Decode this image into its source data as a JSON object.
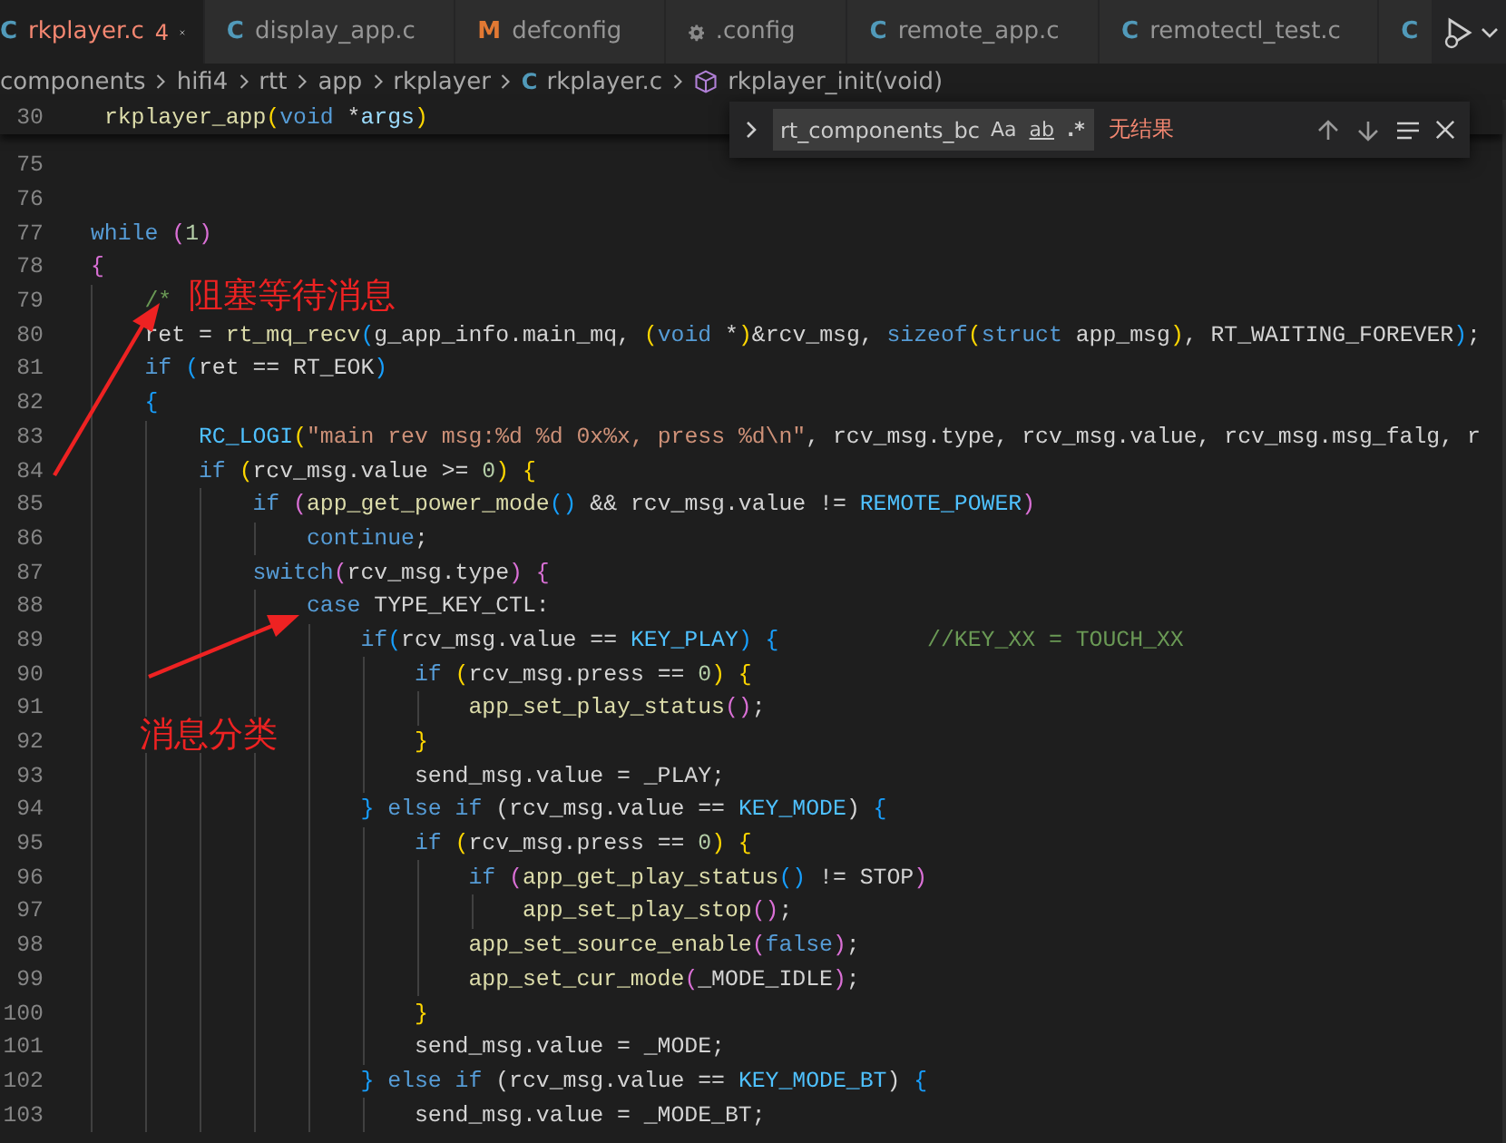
{
  "tabs": [
    {
      "label": "rkplayer.c",
      "kind": "c",
      "glyph": "C",
      "badge": "4",
      "selected": true
    },
    {
      "label": "display_app.c",
      "kind": "c",
      "glyph": "C",
      "selected": false
    },
    {
      "label": "defconfig",
      "kind": "makefile",
      "glyph": "M",
      "selected": false
    },
    {
      "label": ".config",
      "kind": "config",
      "selected": false
    },
    {
      "label": "remote_app.c",
      "kind": "c",
      "glyph": "C",
      "selected": false
    },
    {
      "label": "remotectl_test.c",
      "kind": "c",
      "glyph": "C",
      "selected": false
    },
    {
      "kind": "c",
      "glyph": "C",
      "selected": false
    }
  ],
  "breadcrumbs": [
    {
      "label": "components",
      "kind": "folder"
    },
    {
      "label": "hifi4",
      "kind": "folder"
    },
    {
      "label": "rtt",
      "kind": "folder"
    },
    {
      "label": "app",
      "kind": "folder"
    },
    {
      "label": "rkplayer",
      "kind": "folder"
    },
    {
      "label": "rkplayer.c",
      "kind": "file",
      "glyph": "C"
    },
    {
      "label": "rkplayer_init(void)",
      "kind": "function"
    }
  ],
  "sticky_line": {
    "number": "30",
    "tokens": [
      {
        "t": " rkplayer_app",
        "kind": "fn"
      },
      {
        "t": "(",
        "kind": "b1"
      },
      {
        "t": "void",
        "kind": "kw"
      },
      {
        "t": " *",
        "kind": "plain"
      },
      {
        "t": "args",
        "kind": "var"
      },
      {
        "t": ")",
        "kind": "b1"
      }
    ]
  },
  "find_widget": {
    "value": "rt_components_bc",
    "options": [
      {
        "label": "Aa",
        "kind": "case"
      },
      {
        "label": "ab",
        "kind": "word"
      },
      {
        "label": ".*",
        "kind": "regex"
      }
    ],
    "result": "无结果"
  },
  "code_lines": [
    {
      "number": "75"
    },
    {
      "number": "76"
    },
    {
      "number": "77",
      "tokens": [
        {
          "t": "while ",
          "kind": "kw"
        },
        {
          "t": "(",
          "kind": "b2"
        },
        {
          "t": "1",
          "kind": "num"
        },
        {
          "t": ")",
          "kind": "b2"
        }
      ]
    },
    {
      "number": "78",
      "tokens": [
        {
          "t": "{",
          "kind": "b2"
        }
      ]
    },
    {
      "number": "79",
      "tokens": [
        {
          "t": "    /*",
          "kind": "cmt"
        }
      ]
    },
    {
      "number": "80",
      "tokens": [
        {
          "t": "    ret = ",
          "kind": "plain"
        },
        {
          "t": "rt_mq_recv",
          "kind": "fn"
        },
        {
          "t": "(",
          "kind": "b3"
        },
        {
          "t": "g_app_info.main_mq, ",
          "kind": "plain"
        },
        {
          "t": "(",
          "kind": "b1"
        },
        {
          "t": "void",
          "kind": "kw"
        },
        {
          "t": " *",
          "kind": "plain"
        },
        {
          "t": ")",
          "kind": "b1"
        },
        {
          "t": "&rcv_msg, ",
          "kind": "plain"
        },
        {
          "t": "sizeof",
          "kind": "kw"
        },
        {
          "t": "(",
          "kind": "b1"
        },
        {
          "t": "struct",
          "kind": "kw"
        },
        {
          "t": " app_msg",
          "kind": "plain"
        },
        {
          "t": ")",
          "kind": "b1"
        },
        {
          "t": ", RT_WAITING_FOREVER",
          "kind": "plain"
        },
        {
          "t": ")",
          "kind": "b3"
        },
        {
          "t": ";",
          "kind": "plain"
        }
      ]
    },
    {
      "number": "81",
      "tokens": [
        {
          "t": "    if ",
          "kind": "kw"
        },
        {
          "t": "(",
          "kind": "b3"
        },
        {
          "t": "ret == RT_EOK",
          "kind": "plain"
        },
        {
          "t": ")",
          "kind": "b3"
        }
      ]
    },
    {
      "number": "82",
      "tokens": [
        {
          "t": "    {",
          "kind": "b3"
        }
      ]
    },
    {
      "number": "83",
      "tokens": [
        {
          "t": "        RC_LOGI",
          "kind": "const"
        },
        {
          "t": "(",
          "kind": "b1"
        },
        {
          "t": "\"main rev msg:%d %d 0x%x, press %d\\n\"",
          "kind": "str"
        },
        {
          "t": ", rcv_msg.type, rcv_msg.value, rcv_msg.msg_falg, r",
          "kind": "plain"
        }
      ]
    },
    {
      "number": "84",
      "tokens": [
        {
          "t": "        if ",
          "kind": "kw"
        },
        {
          "t": "(",
          "kind": "b1"
        },
        {
          "t": "rcv_msg.value >= ",
          "kind": "plain"
        },
        {
          "t": "0",
          "kind": "num"
        },
        {
          "t": ")",
          "kind": "b1"
        },
        {
          "t": " {",
          "kind": "b1"
        }
      ]
    },
    {
      "number": "85",
      "tokens": [
        {
          "t": "            if ",
          "kind": "kw"
        },
        {
          "t": "(",
          "kind": "b2"
        },
        {
          "t": "app_get_power_mode",
          "kind": "fn"
        },
        {
          "t": "()",
          "kind": "b3"
        },
        {
          "t": " && rcv_msg.value != ",
          "kind": "plain"
        },
        {
          "t": "REMOTE_POWER",
          "kind": "const"
        },
        {
          "t": ")",
          "kind": "b2"
        }
      ]
    },
    {
      "number": "86",
      "tokens": [
        {
          "t": "                continue",
          "kind": "kw"
        },
        {
          "t": ";",
          "kind": "plain"
        }
      ]
    },
    {
      "number": "87",
      "tokens": [
        {
          "t": "            switch",
          "kind": "kw"
        },
        {
          "t": "(",
          "kind": "b2"
        },
        {
          "t": "rcv_msg.type",
          "kind": "plain"
        },
        {
          "t": ")",
          "kind": "b2"
        },
        {
          "t": " {",
          "kind": "b2"
        }
      ]
    },
    {
      "number": "88",
      "tokens": [
        {
          "t": "                case",
          "kind": "kw"
        },
        {
          "t": " TYPE_KEY_CTL:",
          "kind": "plain"
        }
      ]
    },
    {
      "number": "89",
      "tokens": [
        {
          "t": "                    if",
          "kind": "kw"
        },
        {
          "t": "(",
          "kind": "b3"
        },
        {
          "t": "rcv_msg.value == ",
          "kind": "plain"
        },
        {
          "t": "KEY_PLAY",
          "kind": "const"
        },
        {
          "t": ")",
          "kind": "b3"
        },
        {
          "t": " {",
          "kind": "b3"
        },
        {
          "t": "           //KEY_XX = TOUCH_XX",
          "kind": "cmt"
        }
      ]
    },
    {
      "number": "90",
      "tokens": [
        {
          "t": "                        if ",
          "kind": "kw"
        },
        {
          "t": "(",
          "kind": "b1"
        },
        {
          "t": "rcv_msg.press == ",
          "kind": "plain"
        },
        {
          "t": "0",
          "kind": "num"
        },
        {
          "t": ")",
          "kind": "b1"
        },
        {
          "t": " {",
          "kind": "b1"
        }
      ]
    },
    {
      "number": "91",
      "tokens": [
        {
          "t": "                            app_set_play_status",
          "kind": "fn"
        },
        {
          "t": "()",
          "kind": "b2"
        },
        {
          "t": ";",
          "kind": "plain"
        }
      ]
    },
    {
      "number": "92",
      "tokens": [
        {
          "t": "                        }",
          "kind": "b1"
        }
      ]
    },
    {
      "number": "93",
      "tokens": [
        {
          "t": "                        send_msg.value = _PLAY;",
          "kind": "plain"
        }
      ]
    },
    {
      "number": "94",
      "tokens": [
        {
          "t": "                    }",
          "kind": "b3"
        },
        {
          "t": " else if",
          "kind": "kw"
        },
        {
          "t": " (rcv_msg.value == ",
          "kind": "plain"
        },
        {
          "t": "KEY_MODE",
          "kind": "const"
        },
        {
          "t": ")",
          "kind": "plain"
        },
        {
          "t": " {",
          "kind": "b3"
        }
      ]
    },
    {
      "number": "95",
      "tokens": [
        {
          "t": "                        if ",
          "kind": "kw"
        },
        {
          "t": "(",
          "kind": "b1"
        },
        {
          "t": "rcv_msg.press == ",
          "kind": "plain"
        },
        {
          "t": "0",
          "kind": "num"
        },
        {
          "t": ")",
          "kind": "b1"
        },
        {
          "t": " {",
          "kind": "b1"
        }
      ]
    },
    {
      "number": "96",
      "tokens": [
        {
          "t": "                            if ",
          "kind": "kw"
        },
        {
          "t": "(",
          "kind": "b2"
        },
        {
          "t": "app_get_play_status",
          "kind": "fn"
        },
        {
          "t": "()",
          "kind": "b3"
        },
        {
          "t": " != STOP",
          "kind": "plain"
        },
        {
          "t": ")",
          "kind": "b2"
        }
      ]
    },
    {
      "number": "97",
      "tokens": [
        {
          "t": "                                app_set_play_stop",
          "kind": "fn"
        },
        {
          "t": "()",
          "kind": "b2"
        },
        {
          "t": ";",
          "kind": "plain"
        }
      ]
    },
    {
      "number": "98",
      "tokens": [
        {
          "t": "                            app_set_source_enable",
          "kind": "fn"
        },
        {
          "t": "(",
          "kind": "b2"
        },
        {
          "t": "false",
          "kind": "kw"
        },
        {
          "t": ")",
          "kind": "b2"
        },
        {
          "t": ";",
          "kind": "plain"
        }
      ]
    },
    {
      "number": "99",
      "tokens": [
        {
          "t": "                            app_set_cur_mode",
          "kind": "fn"
        },
        {
          "t": "(",
          "kind": "b2"
        },
        {
          "t": "_MODE_IDLE",
          "kind": "plain"
        },
        {
          "t": ")",
          "kind": "b2"
        },
        {
          "t": ";",
          "kind": "plain"
        }
      ]
    },
    {
      "number": "100",
      "tokens": [
        {
          "t": "                        }",
          "kind": "b1"
        }
      ]
    },
    {
      "number": "101",
      "tokens": [
        {
          "t": "                        send_msg.value = _MODE;",
          "kind": "plain"
        }
      ]
    },
    {
      "number": "102",
      "tokens": [
        {
          "t": "                    }",
          "kind": "b3"
        },
        {
          "t": " else if",
          "kind": "kw"
        },
        {
          "t": " (rcv_msg.value == ",
          "kind": "plain"
        },
        {
          "t": "KEY_MODE_BT",
          "kind": "const"
        },
        {
          "t": ")",
          "kind": "plain"
        },
        {
          "t": " {",
          "kind": "b3"
        }
      ]
    },
    {
      "number": "103",
      "tokens": [
        {
          "t": "                        send_msg.value = _MODE_BT;",
          "kind": "plain"
        }
      ]
    }
  ],
  "annotations": [
    {
      "text": "阻塞等待消息"
    },
    {
      "text": "消息分类"
    }
  ]
}
